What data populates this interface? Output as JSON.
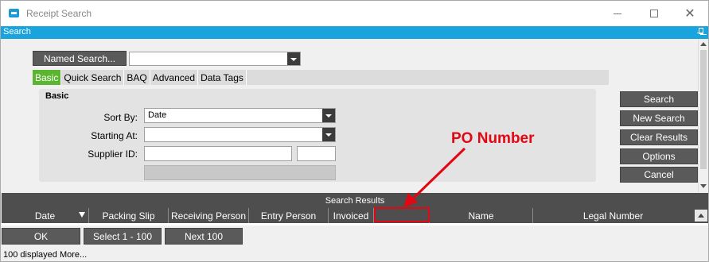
{
  "window": {
    "title": "Receipt Search"
  },
  "search_strip": {
    "label": "Search"
  },
  "named_search": {
    "button_label": "Named Search...",
    "value": ""
  },
  "tabs": [
    {
      "label": "Basic",
      "active": true
    },
    {
      "label": "Quick Search",
      "active": false
    },
    {
      "label": "BAQ",
      "active": false
    },
    {
      "label": "Advanced",
      "active": false
    },
    {
      "label": "Data Tags",
      "active": false
    }
  ],
  "basic": {
    "group_title": "Basic",
    "sort_by_label": "Sort By:",
    "sort_by_value": "Date",
    "starting_at_label": "Starting At:",
    "starting_at_value": "",
    "supplier_id_label": "Supplier ID:",
    "supplier_id_value": "",
    "supplier_id_value2": ""
  },
  "actions": {
    "search": "Search",
    "new_search": "New Search",
    "clear_results": "Clear Results",
    "options": "Options",
    "cancel": "Cancel"
  },
  "results": {
    "header": "Search Results",
    "columns": [
      "Date",
      "Packing Slip",
      "Receiving Person",
      "Entry Person",
      "Invoiced",
      "",
      "Name",
      "Legal Number"
    ]
  },
  "footer": {
    "ok": "OK",
    "select": "Select 1 - 100",
    "next": "Next 100",
    "status": "100 displayed More..."
  },
  "annotation": {
    "label": "PO Number",
    "color": "#e30613"
  },
  "colors": {
    "accent": "#1aa4dd",
    "active_tab": "#5cb531",
    "dark_button": "#5a5a5a"
  }
}
